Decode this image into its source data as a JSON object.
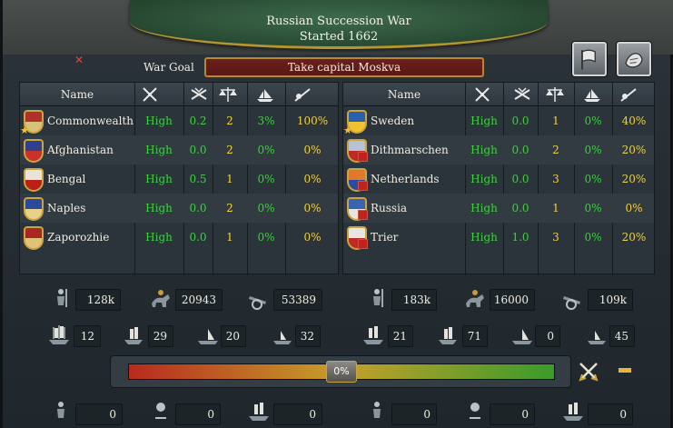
{
  "war": {
    "title": "Russian Succession War",
    "started": "Started 1662",
    "goal_label": "War Goal",
    "goal_value": "Take capital Moskva"
  },
  "headers": {
    "name": "Name"
  },
  "attackers": [
    {
      "name": "Commonwealth",
      "c1": "High",
      "c2": "0.2",
      "c3": "2",
      "c4": "3%",
      "c5": "100%",
      "colors": [
        "#b0302a",
        "#d8c27a"
      ]
    },
    {
      "name": "Afghanistan",
      "c1": "High",
      "c2": "0.0",
      "c3": "2",
      "c4": "0%",
      "c5": "0%",
      "colors": [
        "#2e3f8c",
        "#c9322a"
      ]
    },
    {
      "name": "Bengal",
      "c1": "High",
      "c2": "0.5",
      "c3": "1",
      "c4": "0%",
      "c5": "0%",
      "colors": [
        "#e9e4d9",
        "#b8211a"
      ]
    },
    {
      "name": "Naples",
      "c1": "High",
      "c2": "0.0",
      "c3": "2",
      "c4": "0%",
      "c5": "0%",
      "colors": [
        "#2c4a9c",
        "#e8d28a"
      ]
    },
    {
      "name": "Zaporozhie",
      "c1": "High",
      "c2": "0.0",
      "c3": "1",
      "c4": "0%",
      "c5": "0%",
      "colors": [
        "#a82720",
        "#e0c27a"
      ]
    }
  ],
  "defenders": [
    {
      "name": "Sweden",
      "c1": "High",
      "c2": "0.0",
      "c3": "1",
      "c4": "0%",
      "c5": "40%",
      "colors": [
        "#2a5fae",
        "#f1c233"
      ]
    },
    {
      "name": "Dithmarschen",
      "c1": "High",
      "c2": "0.0",
      "c3": "2",
      "c4": "0%",
      "c5": "20%",
      "colors": [
        "#b8c2d6",
        "#c02a24"
      ]
    },
    {
      "name": "Netherlands",
      "c1": "High",
      "c2": "0.0",
      "c3": "3",
      "c4": "0%",
      "c5": "20%",
      "colors": [
        "#e07a2a",
        "#2c4aa0"
      ]
    },
    {
      "name": "Russia",
      "c1": "High",
      "c2": "0.0",
      "c3": "1",
      "c4": "0%",
      "c5": "0%",
      "colors": [
        "#3a63b0",
        "#e8e6e0"
      ]
    },
    {
      "name": "Trier",
      "c1": "High",
      "c2": "1.0",
      "c3": "3",
      "c4": "0%",
      "c5": "20%",
      "colors": [
        "#e8e6e0",
        "#c02a24"
      ]
    }
  ],
  "stats": {
    "left": {
      "infantry": "128k",
      "cavalry": "20943",
      "artillery": "53389",
      "heavy": "12",
      "light": "29",
      "galley": "20",
      "transport": "32"
    },
    "right": {
      "infantry": "183k",
      "cavalry": "16000",
      "artillery": "109k",
      "heavy": "21",
      "light": "71",
      "galley": "0",
      "transport": "45"
    },
    "bottom": {
      "l1": "0",
      "l2": "0",
      "l3": "0",
      "r1": "0",
      "r2": "0",
      "r3": "0"
    }
  },
  "score": {
    "value": "0%",
    "fraction": 0.5
  },
  "icons": [
    "close-icon",
    "white-peace-icon",
    "peace-offer-icon",
    "participation-icon",
    "swords-icon"
  ]
}
